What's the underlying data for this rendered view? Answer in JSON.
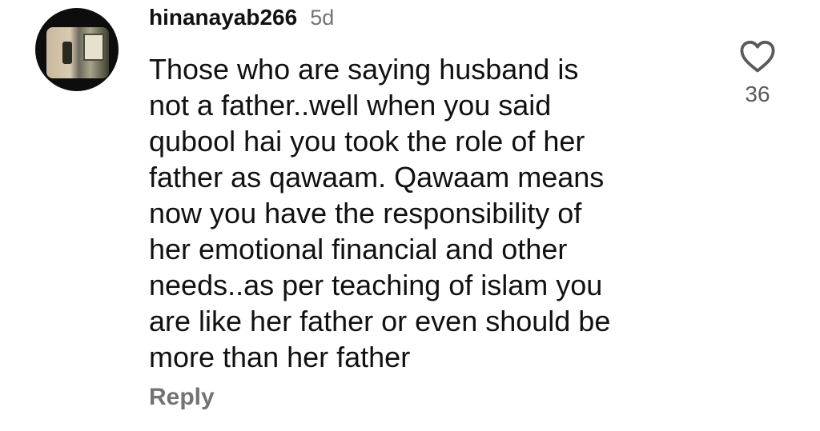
{
  "comment": {
    "username": "hinanayab266",
    "time": "5d",
    "text_lines": [
      "Those who are saying husband is",
      "not a father..well when you said",
      "qubool hai you took the role of her",
      "father as qawaam. Qawaam means",
      "now you have the responsibility of",
      "her emotional financial and other",
      "needs..as per teaching of islam you",
      "are like her father or even should be",
      "more than her father"
    ],
    "reply_label": "Reply",
    "like_count": "36",
    "icons": {
      "like": "heart-outline-icon"
    },
    "colors": {
      "text": "#111111",
      "muted": "#737373"
    }
  }
}
